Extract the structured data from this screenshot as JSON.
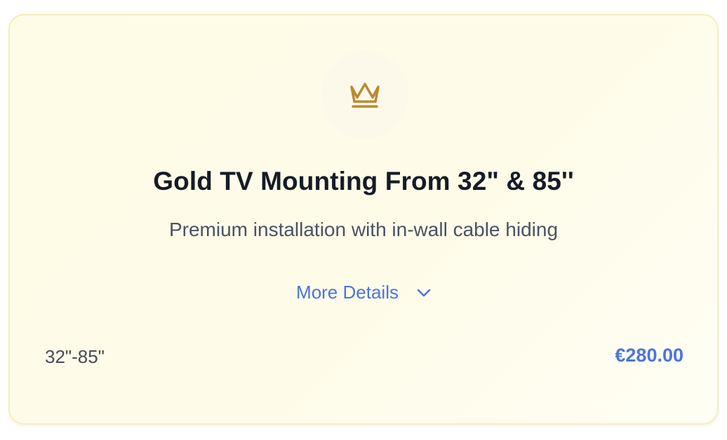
{
  "card": {
    "icon": "crown-icon",
    "title": "Gold TV Mounting From 32\" & 85''",
    "subtitle": "Premium installation with in-wall cable hiding",
    "details_label": "More Details",
    "size_label": "32\"-85\"",
    "price": "€280.00"
  },
  "colors": {
    "accent": "#4b74e0",
    "gold": "#b98a2e",
    "card_background": "#fefbe6",
    "card_border": "#f6eeb8"
  }
}
